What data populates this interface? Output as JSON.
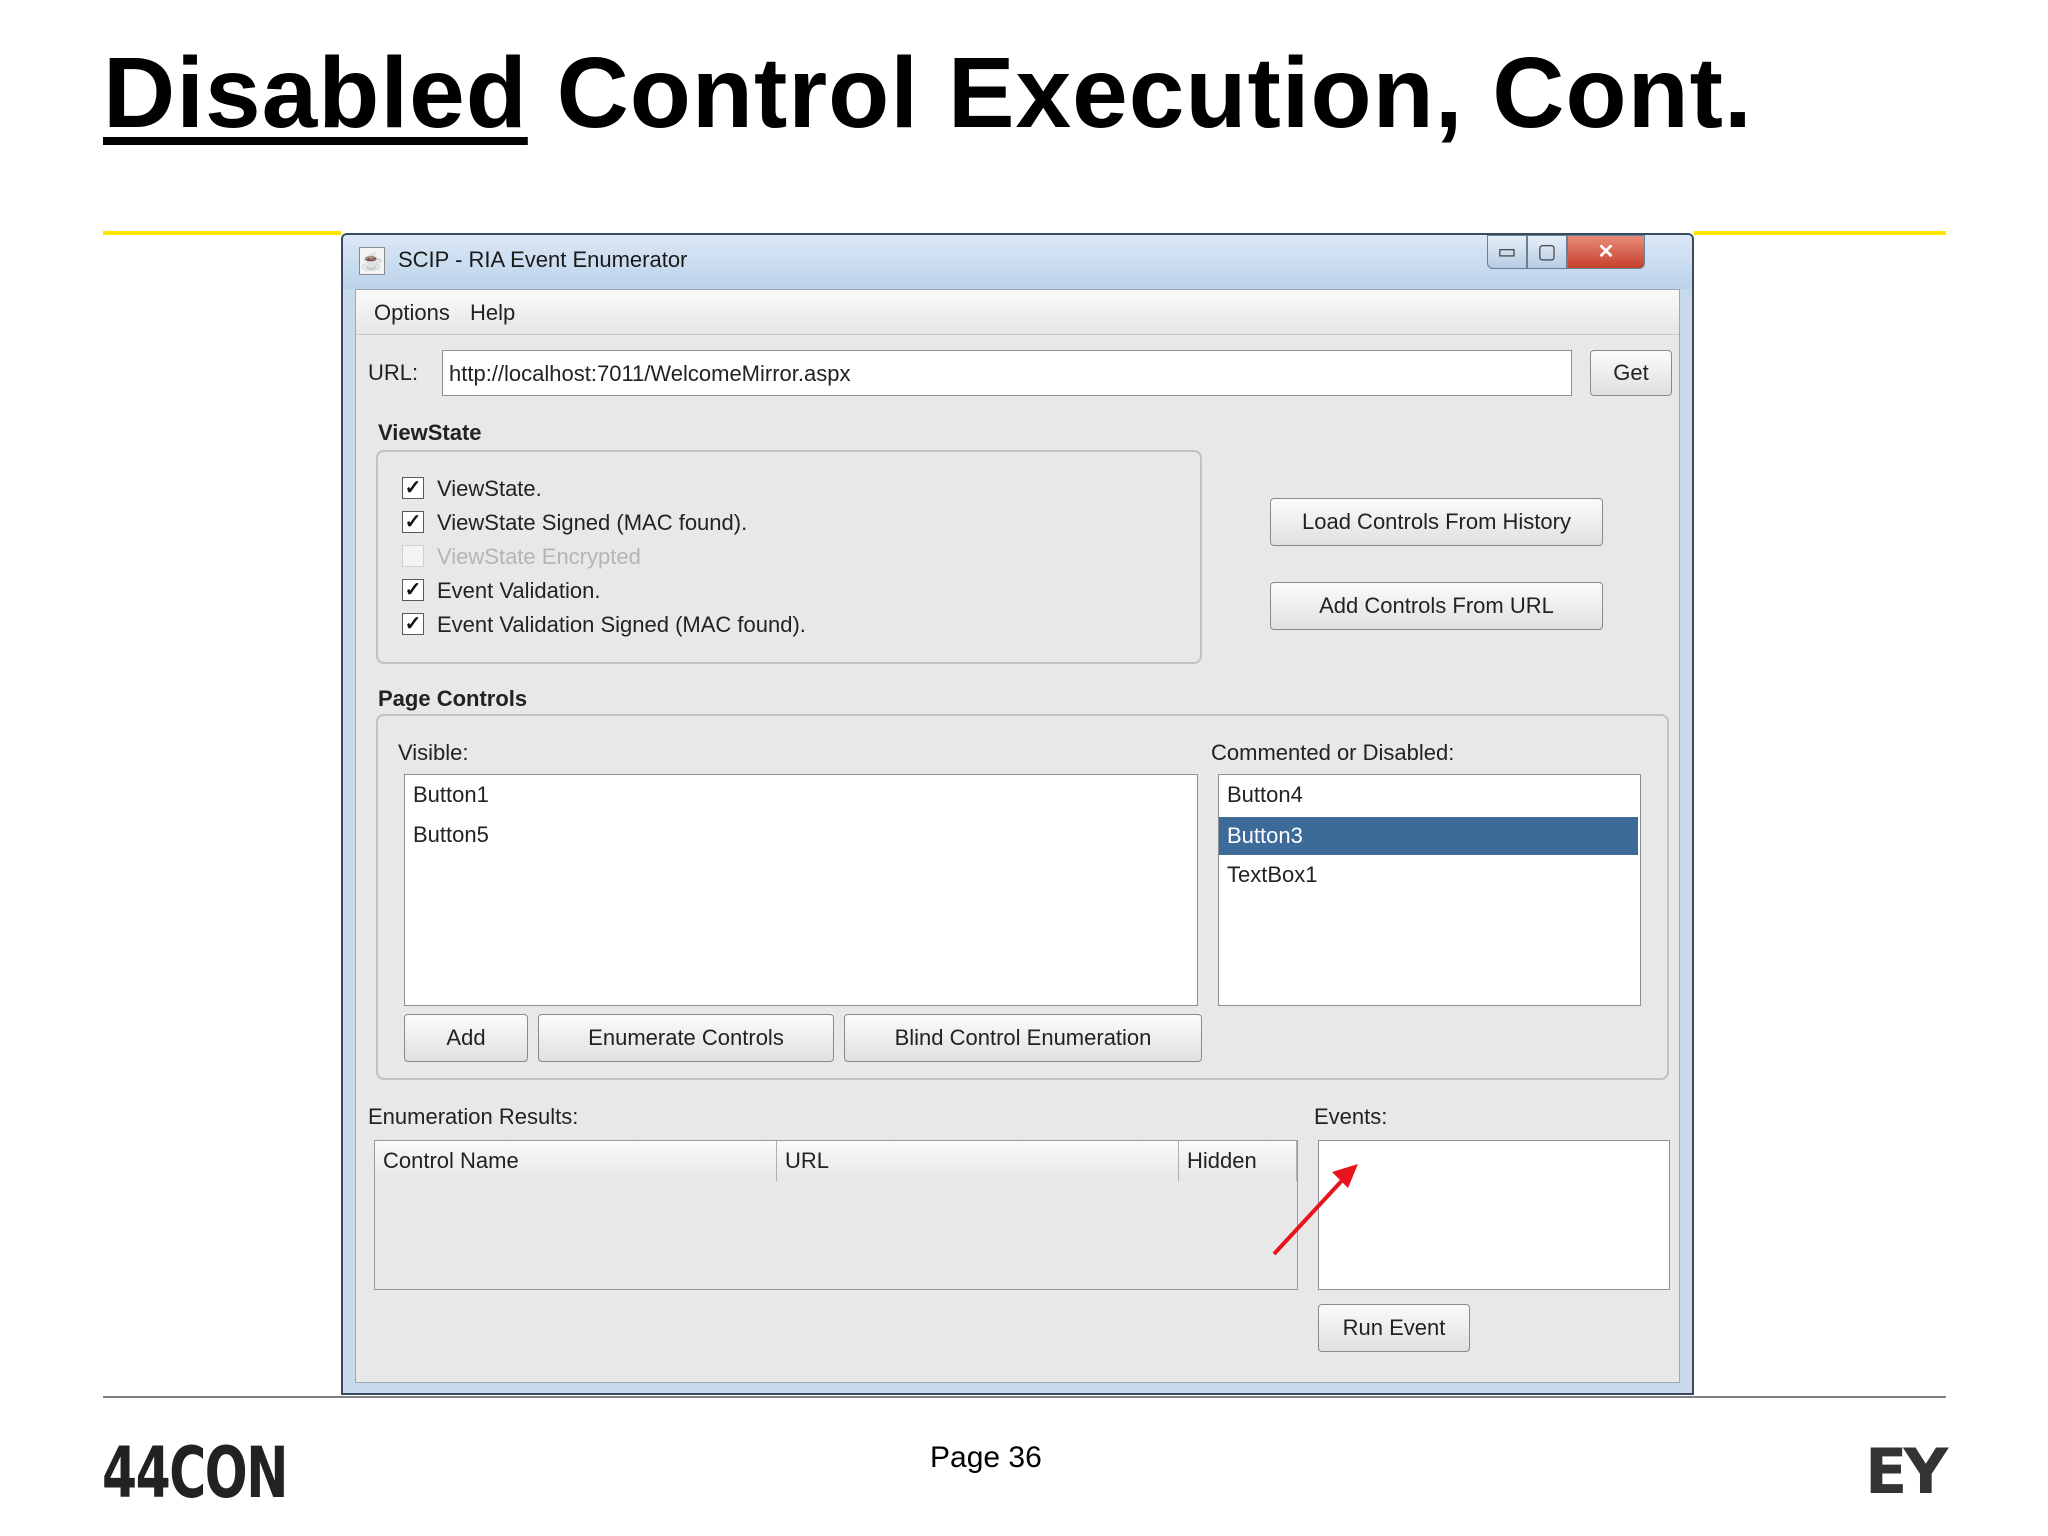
{
  "slide": {
    "title_underlined": "Disabled",
    "title_rest": " Control Execution, Cont.",
    "page_label": "Page 36",
    "logo_left": "44CON",
    "logo_right": "EY"
  },
  "window": {
    "title": "SCIP - RIA Event Enumerator",
    "icon": "java-cup-icon",
    "controls": {
      "minimize": "▭",
      "maximize": "▢",
      "close": "✕"
    }
  },
  "menu": {
    "items": [
      "Options",
      "Help"
    ]
  },
  "url_bar": {
    "label": "URL:",
    "value": "http://localhost:7011/WelcomeMirror.aspx",
    "get_button": "Get"
  },
  "viewstate": {
    "heading": "ViewState",
    "checks": [
      {
        "label": "ViewState.",
        "checked": true,
        "enabled": true
      },
      {
        "label": "ViewState Signed (MAC found).",
        "checked": true,
        "enabled": true
      },
      {
        "label": "ViewState Encrypted",
        "checked": false,
        "enabled": false
      },
      {
        "label": "Event Validation.",
        "checked": true,
        "enabled": true
      },
      {
        "label": "Event Validation Signed (MAC found).",
        "checked": true,
        "enabled": true
      }
    ],
    "load_history_button": "Load Controls From History",
    "add_url_button": "Add Controls From URL"
  },
  "page_controls": {
    "heading": "Page Controls",
    "visible_label": "Visible:",
    "visible_items": [
      "Button1",
      "Button5"
    ],
    "disabled_label": "Commented or Disabled:",
    "disabled_items": [
      "Button4",
      "Button3",
      "TextBox1"
    ],
    "selected_disabled": "Button3",
    "add_button": "Add",
    "enumerate_button": "Enumerate Controls",
    "blind_button": "Blind Control Enumeration"
  },
  "results": {
    "label": "Enumeration Results:",
    "columns": [
      "Control Name",
      "URL",
      "Hidden"
    ],
    "events_label": "Events:",
    "run_button": "Run Event"
  },
  "annotation": {
    "arrow_color": "#e8141b"
  },
  "colors": {
    "accent_yellow": "#ffe600",
    "selection": "#3d6b99"
  }
}
